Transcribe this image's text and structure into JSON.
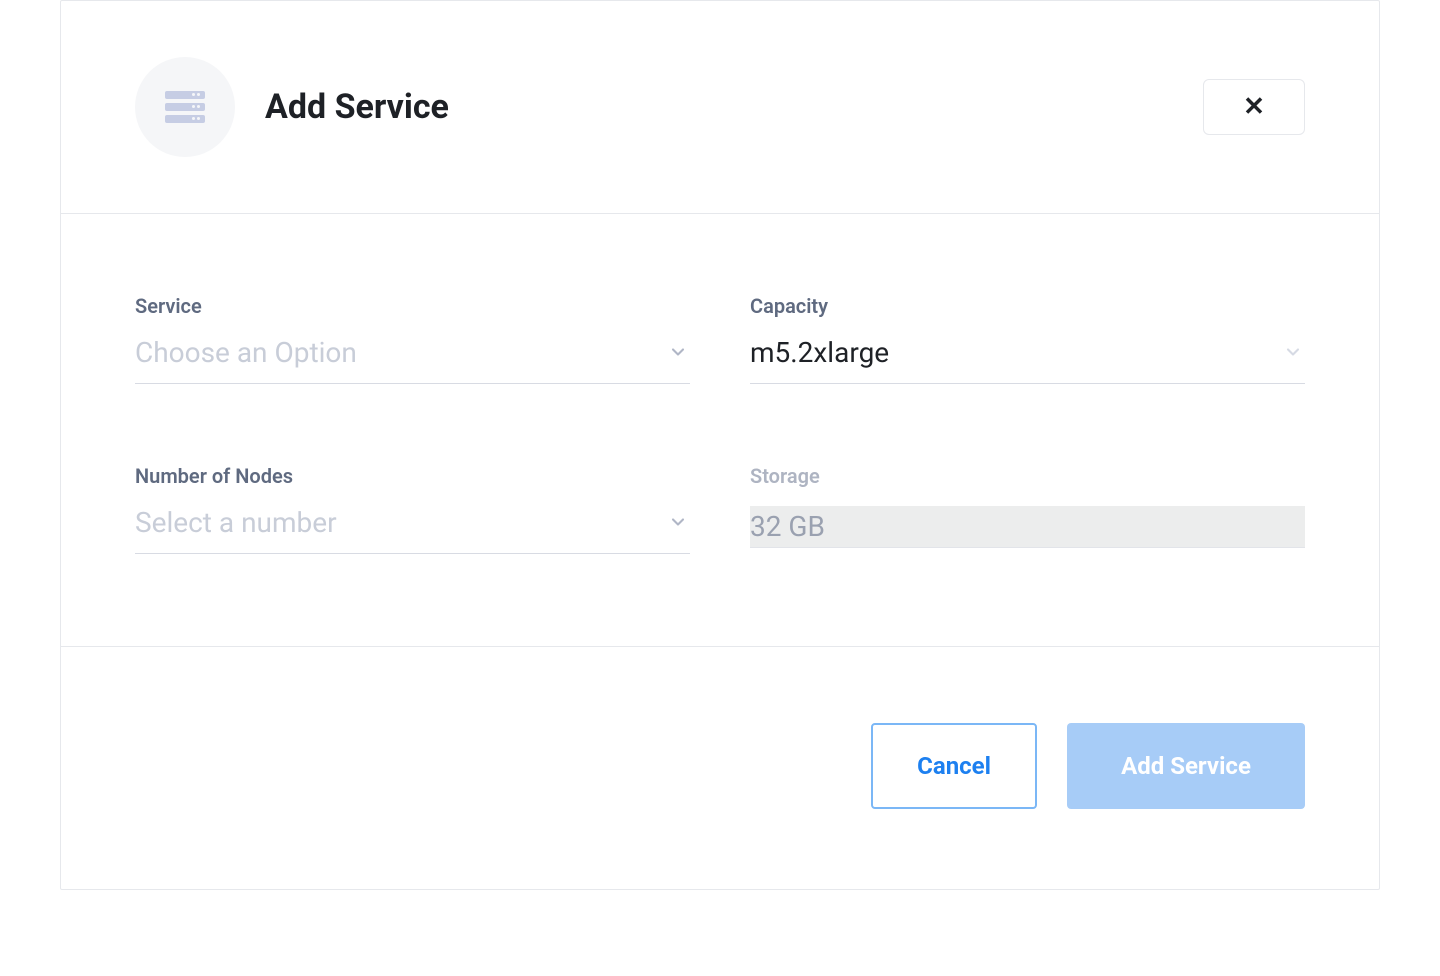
{
  "header": {
    "title": "Add Service"
  },
  "fields": {
    "service": {
      "label": "Service",
      "placeholder": "Choose an Option",
      "value": ""
    },
    "capacity": {
      "label": "Capacity",
      "value": "m5.2xlarge"
    },
    "nodes": {
      "label": "Number of Nodes",
      "placeholder": "Select a number",
      "value": ""
    },
    "storage": {
      "label": "Storage",
      "value": "32 GB"
    }
  },
  "footer": {
    "cancel": "Cancel",
    "submit": "Add Service"
  }
}
